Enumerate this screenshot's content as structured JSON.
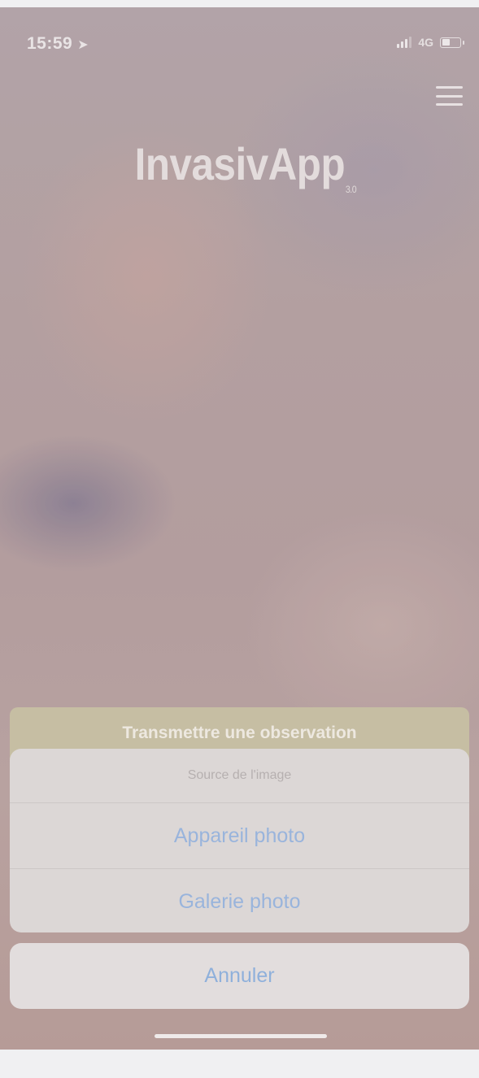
{
  "status_bar": {
    "time": "15:59",
    "location_icon": "location-arrow-icon",
    "network": "4G",
    "signal_bars": 3,
    "battery_level": 0.45
  },
  "header": {
    "menu_icon": "hamburger-menu-icon"
  },
  "logo": {
    "title": "InvasivApp",
    "version": "3.0"
  },
  "primary_action": {
    "label": "Transmettre une observation",
    "color": "#c6bea3"
  },
  "action_sheet": {
    "title": "Source de l'image",
    "options": [
      {
        "label": "Appareil photo"
      },
      {
        "label": "Galerie photo"
      }
    ],
    "cancel_label": "Annuler",
    "accent_color": "#99b4dc"
  }
}
